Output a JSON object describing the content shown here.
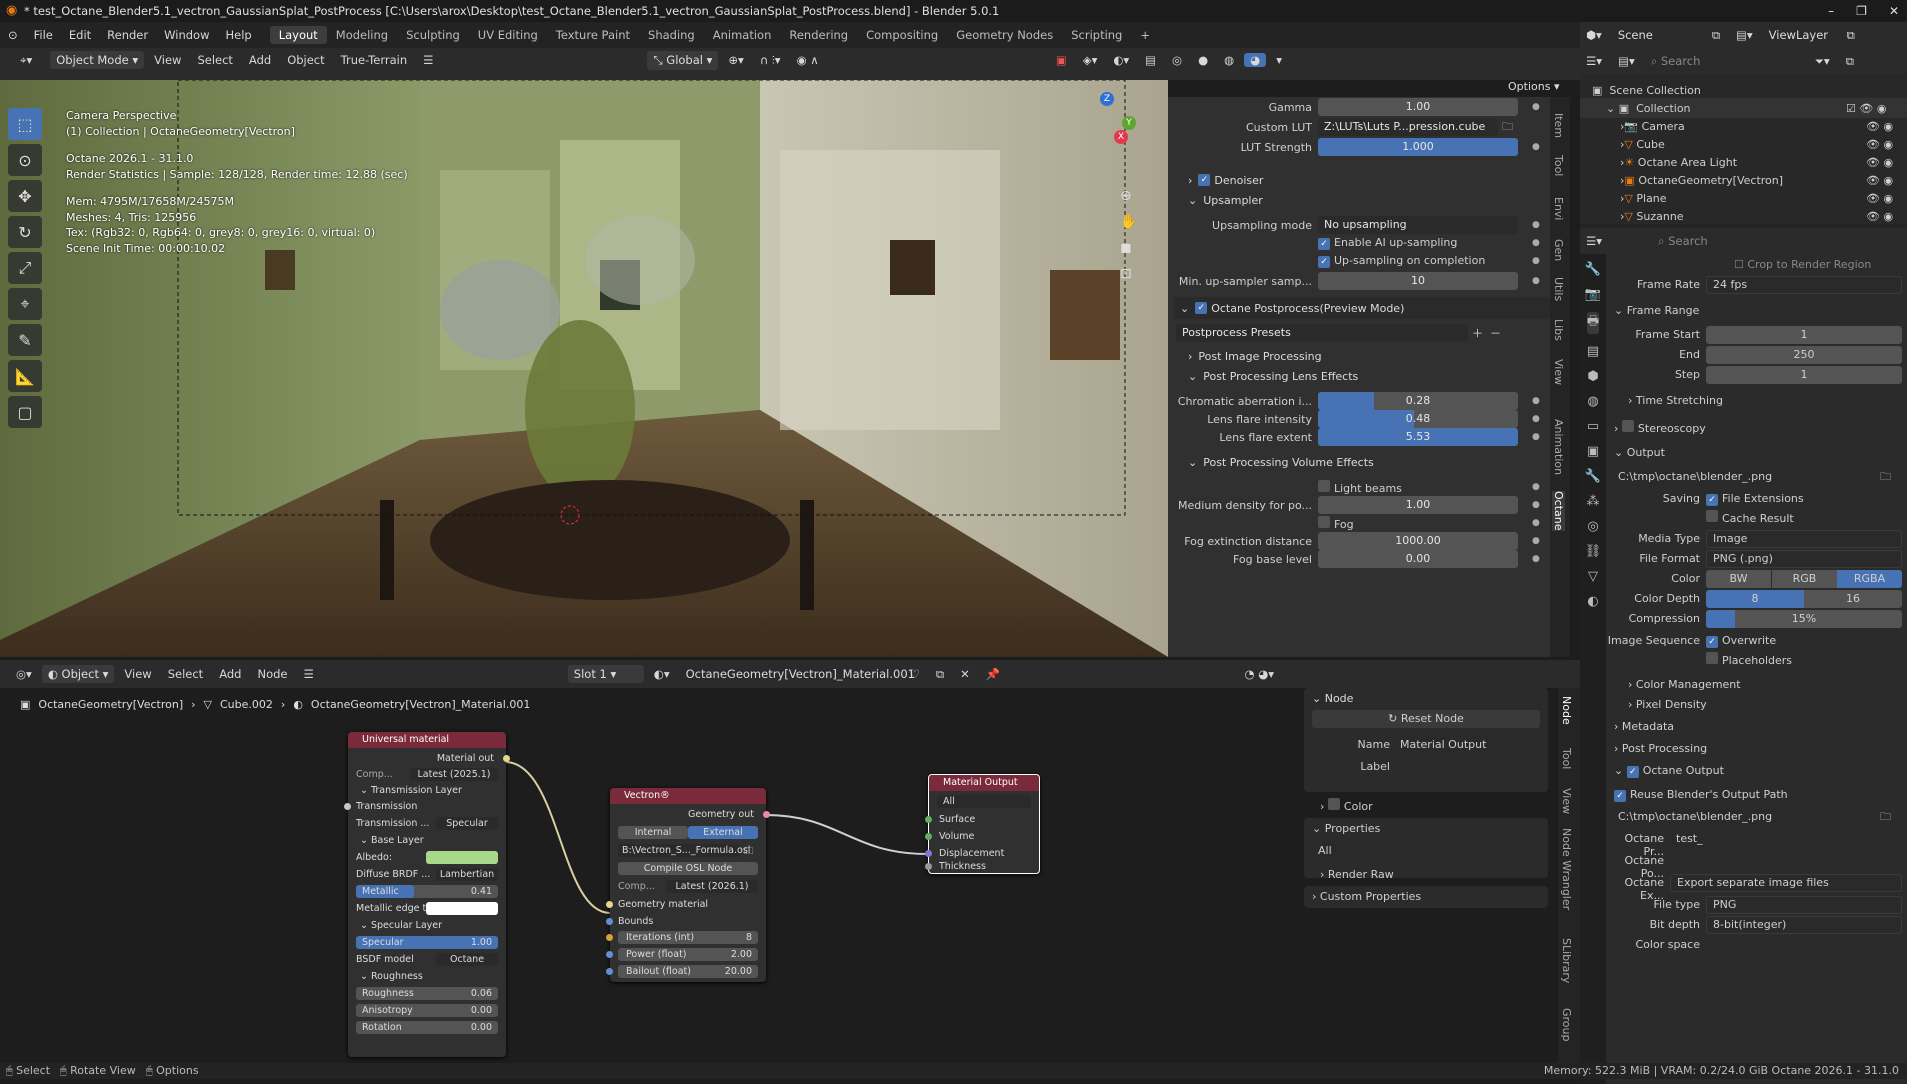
{
  "window": {
    "title": "* test_Octane_Blender5.1_vectron_GaussianSplat_PostProcess [C:\\Users\\arox\\Desktop\\test_Octane_Blender5.1_vectron_GaussianSplat_PostProcess.blend] - Blender 5.0.1",
    "minimize": "–",
    "maximize": "❐",
    "close": "✕"
  },
  "menu": {
    "items": [
      "File",
      "Edit",
      "Render",
      "Window",
      "Help"
    ],
    "workspaces": [
      "Layout",
      "Modeling",
      "Sculpting",
      "UV Editing",
      "Texture Paint",
      "Shading",
      "Animation",
      "Rendering",
      "Compositing",
      "Geometry Nodes",
      "Scripting"
    ],
    "add": "+"
  },
  "scene": {
    "name": "Scene",
    "view_layer": "ViewLayer"
  },
  "viewport_header": {
    "mode": "Object Mode",
    "menus": [
      "View",
      "Select",
      "Add",
      "Object",
      "True-Terrain"
    ],
    "transform": "Global",
    "options": "Options"
  },
  "viewport_overlay": {
    "lines": [
      "Camera Perspective",
      "(1) Collection | OctaneGeometry[Vectron]",
      "",
      "Octane 2026.1 - 31.1.0",
      "Render Statistics | Sample: 128/128, Render time: 12.88 (sec)",
      "",
      "Mem: 4795M/17658M/24575M",
      "Meshes: 4, Tris: 125956",
      "Tex: (Rgb32: 0, Rgb64: 0, grey8: 0, grey16: 0, virtual: 0)",
      "Scene Init Time: 00:00:10.02"
    ],
    "gizmo_axes": [
      "Z",
      "Y",
      "X"
    ]
  },
  "npanel": {
    "gamma_label": "Gamma",
    "gamma": "1.00",
    "lut_label": "Custom LUT",
    "lut": "Z:\\LUTs\\Luts P...pression.cube",
    "lut_strength_label": "LUT Strength",
    "lut_strength": "1.000",
    "denoiser": "Denoiser",
    "upsampler": "Upsampler",
    "ups_mode_label": "Upsampling mode",
    "ups_mode": "No upsampling",
    "enable_ai": "Enable AI up-sampling",
    "ups_complete": "Up-sampling on completion",
    "min_ups_label": "Min. up-sampler samp...",
    "min_ups": "10",
    "postprocess": "Octane Postprocess(Preview Mode)",
    "presets": "Postprocess Presets",
    "post_image": "Post Image Processing",
    "lens_effects": "Post Processing Lens Effects",
    "chrom_label": "Chromatic aberration i...",
    "chrom": "0.28",
    "chrom_frac": 0.28,
    "flare_int_label": "Lens flare intensity",
    "flare_int": "0.48",
    "flare_int_frac": 0.48,
    "flare_ext_label": "Lens flare extent",
    "flare_ext": "5.53",
    "vol_effects": "Post Processing Volume Effects",
    "light_beams": "Light beams",
    "medium_label": "Medium density for po...",
    "medium": "1.00",
    "fog": "Fog",
    "fog_ext_label": "Fog extinction distance",
    "fog_ext": "1000.00",
    "fog_base_label": "Fog base level",
    "fog_base": "0.00",
    "tabs": [
      "Item",
      "Tool",
      "View",
      "Envi",
      "Gen",
      "Utils",
      "Libs",
      "View",
      "Animation",
      "Octane"
    ]
  },
  "node_header": {
    "mode": "Object",
    "menus": [
      "View",
      "Select",
      "Add",
      "Node"
    ],
    "slot": "Slot 1",
    "material": "OctaneGeometry[Vectron]_Material.001"
  },
  "breadcrumb": [
    "OctaneGeometry[Vectron]",
    "Cube.002",
    "OctaneGeometry[Vectron]_Material.001"
  ],
  "nodes": {
    "universal": {
      "title": "Universal material",
      "out": "Material out",
      "comp_label": "Comp...",
      "comp": "Latest (2025.1)",
      "transmission_layer": "Transmission Layer",
      "transmission": "Transmission",
      "trans_type_label": "Transmission ...",
      "trans_type": "Specular",
      "base_layer": "Base Layer",
      "albedo": "Albedo:",
      "brdf_label": "Diffuse BRDF ...",
      "brdf": "Lambertian",
      "metallic": "Metallic",
      "metallic_val": "0.41",
      "metallic_edge": "Metallic edge ti...",
      "specular_layer": "Specular Layer",
      "specular": "Specular",
      "specular_val": "1.00",
      "bsdf_label": "BSDF model",
      "bsdf": "Octane",
      "roughness_group": "Roughness",
      "roughness": "Roughness",
      "roughness_val": "0.06",
      "anisotropy": "Anisotropy",
      "anisotropy_val": "0.00",
      "rotation": "Rotation",
      "rotation_val": "0.00"
    },
    "vectron": {
      "title": "Vectron®",
      "out": "Geometry out",
      "internal": "Internal",
      "external": "External",
      "path": "B:\\Vectron_S..._Formula.osl",
      "compile": "Compile OSL Node",
      "comp_label": "Comp...",
      "comp": "Latest (2026.1)",
      "geo_mat": "Geometry material",
      "bounds": "Bounds",
      "iter": "Iterations (int)",
      "iter_val": "8",
      "power": "Power (float)",
      "power_val": "2.00",
      "bailout": "Bailout (float)",
      "bailout_val": "20.00"
    },
    "output": {
      "title": "Material Output",
      "target": "All",
      "inputs": [
        "Surface",
        "Volume",
        "Displacement",
        "Thickness"
      ]
    }
  },
  "node_side": {
    "node_sect": "Node",
    "reset": "Reset Node",
    "name_label": "Name",
    "name": "Material Output",
    "label_label": "Label",
    "color": "Color",
    "properties": "Properties",
    "prop_all": "All",
    "render_raw": "Render Raw",
    "custom_props": "Custom Properties",
    "tabs": [
      "Node",
      "Tool",
      "View",
      "Node Wrangler",
      "SLibrary",
      "Group"
    ]
  },
  "outliner": {
    "search": "Search",
    "root": "Scene Collection",
    "collection": "Collection",
    "items": [
      "Camera",
      "Cube",
      "Octane Area Light",
      "OctaneGeometry[Vectron]",
      "Plane",
      "Suzanne"
    ]
  },
  "props": {
    "search": "Search",
    "crop": "Crop to Render Region",
    "frame_rate_label": "Frame Rate",
    "frame_rate": "24 fps",
    "frame_range": "Frame Range",
    "start_label": "Frame Start",
    "start": "1",
    "end_label": "End",
    "end": "250",
    "step_label": "Step",
    "step": "1",
    "time_stretch": "Time Stretching",
    "stereo": "Stereoscopy",
    "output": "Output",
    "path": "C:\\tmp\\octane\\blender_.png",
    "saving": "Saving",
    "file_ext": "File Extensions",
    "cache": "Cache Result",
    "media_label": "Media Type",
    "media": "Image",
    "format_label": "File Format",
    "format": "PNG (.png)",
    "color_label": "Color",
    "color_opts": [
      "BW",
      "RGB",
      "RGBA"
    ],
    "depth_label": "Color Depth",
    "depth_opts": [
      "8",
      "16"
    ],
    "comp_label": "Compression",
    "comp": "15%",
    "comp_frac": 0.15,
    "imgseq": "Image Sequence",
    "overwrite": "Overwrite",
    "placeholders": "Placeholders",
    "color_mgmt": "Color Management",
    "pixel_density": "Pixel Density",
    "metadata": "Metadata",
    "post_processing": "Post Processing",
    "octane_output": "Octane Output",
    "reuse": "Reuse Blender's Output Path",
    "path2": "C:\\tmp\\octane\\blender_.png",
    "opr_label": "Octane Pr...",
    "opr": "test_",
    "opo_label": "Octane Po...",
    "opo": "",
    "oex_label": "Octane Ex...",
    "oex": "Export separate image files",
    "ftype_label": "File type",
    "ftype": "PNG",
    "bitdepth_label": "Bit depth",
    "bitdepth": "8-bit(integer)",
    "colorspace_label": "Color space"
  },
  "status": {
    "select": "Select",
    "rotate": "Rotate View",
    "options": "Options",
    "right": "Memory: 522.3 MiB | VRAM: 0.2/24.0 GiB   Octane 2026.1 - 31.1.0"
  }
}
